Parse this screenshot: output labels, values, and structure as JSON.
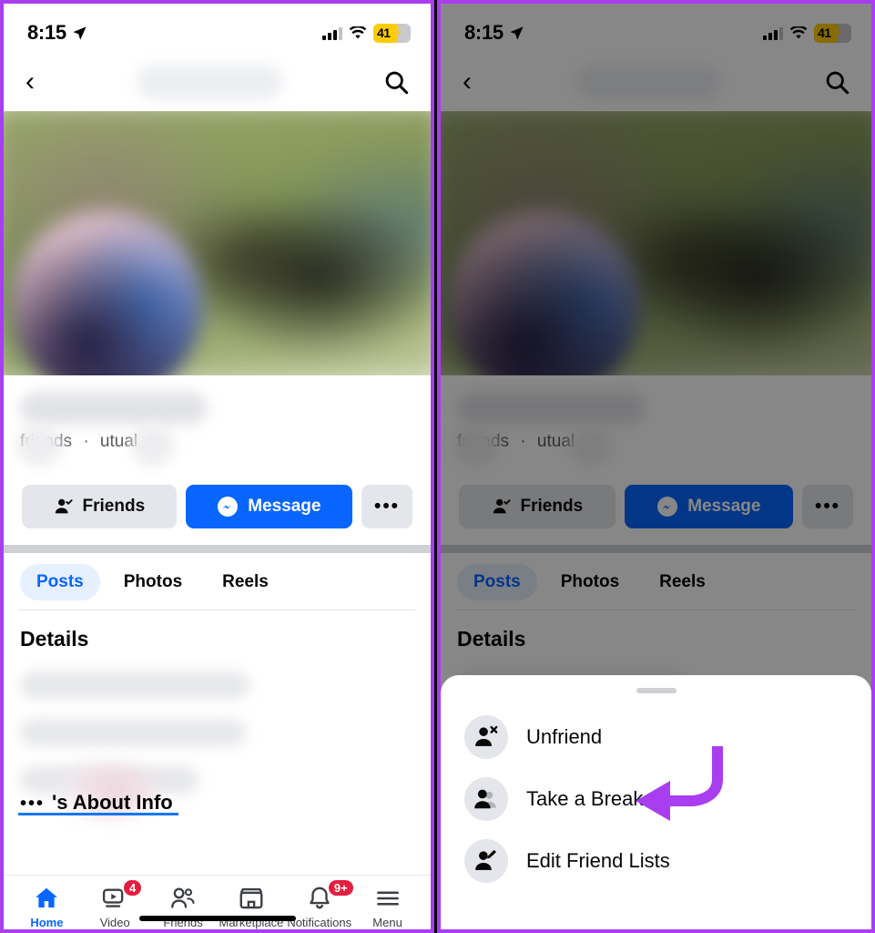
{
  "statusbar": {
    "time": "8:15",
    "location_icon": "location-arrow-icon",
    "battery_pct": "41",
    "battery_bolt": "⚡",
    "signal_icon": "cellular-bars-icon",
    "wifi_icon": "wifi-icon"
  },
  "nav": {
    "back_icon": "chevron-left-icon",
    "search_icon": "search-icon"
  },
  "profile": {
    "name_redacted": "",
    "meta_friends": "friends",
    "meta_separator": "·",
    "meta_mutual": "utual",
    "friends_button": "Friends",
    "message_button": "Message",
    "more_button": "•••"
  },
  "tabs": [
    {
      "label": "Posts",
      "active": true
    },
    {
      "label": "Photos",
      "active": false
    },
    {
      "label": "Reels",
      "active": false
    }
  ],
  "details": {
    "heading": "Details",
    "about_dots": "•••",
    "about_link": "'s About Info"
  },
  "bottomnav": [
    {
      "label": "Home",
      "icon": "home-icon",
      "badge": "",
      "active": true
    },
    {
      "label": "Video",
      "icon": "video-icon",
      "badge": "4",
      "active": false
    },
    {
      "label": "Friends",
      "icon": "friends-icon",
      "badge": "",
      "active": false
    },
    {
      "label": "Marketplace",
      "icon": "marketplace-icon",
      "badge": "",
      "active": false
    },
    {
      "label": "Notifications",
      "icon": "bell-icon",
      "badge": "9+",
      "active": false
    },
    {
      "label": "Menu",
      "icon": "hamburger-icon",
      "badge": "",
      "active": false
    }
  ],
  "sheet": {
    "items": [
      {
        "label": "Unfriend",
        "icon": "person-remove-icon"
      },
      {
        "label": "Take a Break",
        "icon": "people-pause-icon"
      },
      {
        "label": "Edit Friend Lists",
        "icon": "person-edit-icon"
      }
    ]
  },
  "annotation": {
    "arrow_color": "#a93df0",
    "points_to": "Take a Break"
  },
  "colors": {
    "frame_purple": "#a93df0",
    "facebook_blue": "#0866ff",
    "badge_red": "#e41e3f",
    "battery_yellow": "#ffcc00",
    "chip_gray": "#e4e6eb"
  }
}
